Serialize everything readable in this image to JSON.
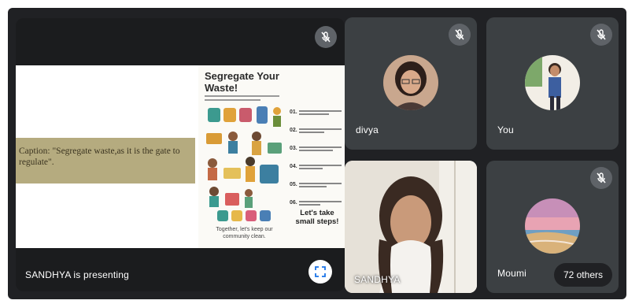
{
  "presentation": {
    "presenter_label": "SANDHYA is presenting",
    "caption": "Caption: \"Segregate waste,as it is the gate to regulate\".",
    "poster": {
      "title": "Segregate Your Waste!",
      "steps": [
        "01.",
        "02.",
        "03.",
        "04.",
        "05.",
        "06."
      ],
      "cta": "Let's take small steps!",
      "footer": "Together, let's keep our community clean."
    }
  },
  "participants": [
    {
      "name": "divya",
      "muted": true
    },
    {
      "name": "You",
      "muted": true
    },
    {
      "name": "SANDHYA",
      "muted": false
    },
    {
      "name": "Moumi",
      "muted": true
    }
  ],
  "others_label": "72 others",
  "colors": {
    "background": "#202124",
    "tile": "#3c4043",
    "mute_badge": "#5f6368",
    "caption_band": "#b5ab7f"
  },
  "icons": [
    "mic-off-icon",
    "fullscreen-icon"
  ]
}
